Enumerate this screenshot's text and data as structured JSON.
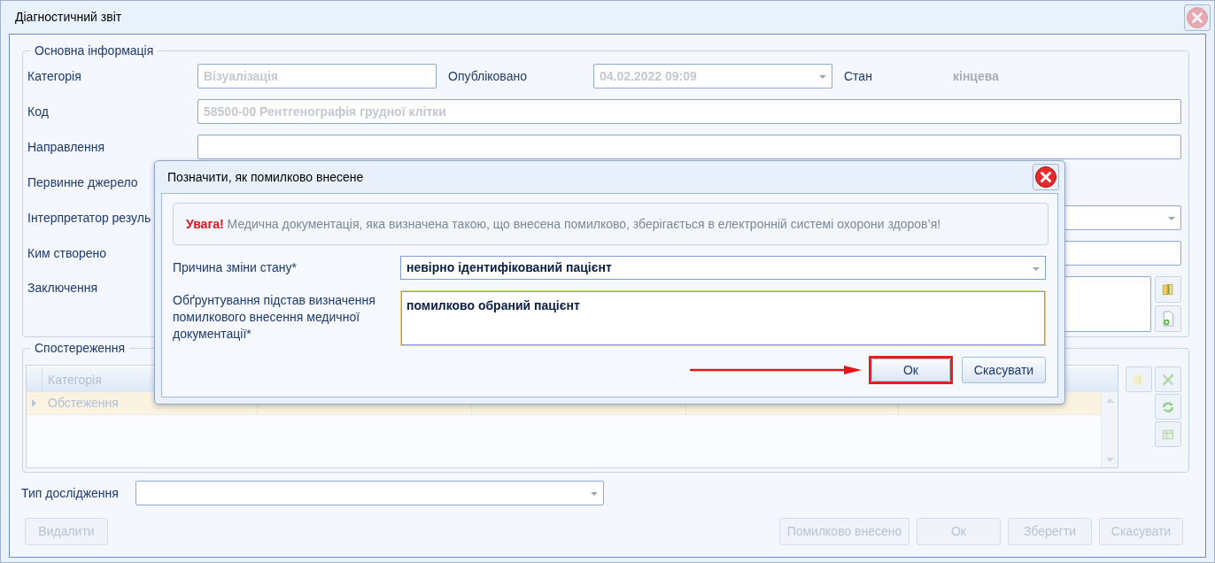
{
  "window": {
    "title": "Діагностичний звіт"
  },
  "main_info": {
    "legend": "Основна інформація",
    "category": {
      "label": "Категорія",
      "value": "Візуалізація"
    },
    "published": {
      "label": "Опубліковано",
      "value": "04.02.2022 09:09"
    },
    "status": {
      "label": "Стан",
      "value": "кінцева"
    },
    "fields": [
      {
        "label": "Код",
        "kind": "text",
        "value": "58500-00 Рентгенографія грудної клітки"
      },
      {
        "label": "Направлення",
        "kind": "text"
      },
      {
        "label": "Первинне джерело",
        "kind": "none"
      },
      {
        "label": "Інтерпретатор резуль",
        "kind": "select"
      },
      {
        "label": "Ким створено",
        "kind": "text"
      },
      {
        "label": "Заключення",
        "kind": "textarea"
      }
    ]
  },
  "observations": {
    "legend": "Спостереження",
    "columns": [
      "Категорія"
    ],
    "rows": [
      {
        "selected": true,
        "cells": [
          "Обстеження"
        ]
      }
    ]
  },
  "study_type": {
    "label": "Тип дослідження"
  },
  "buttons": [
    {
      "label": "Видалити",
      "disabled": true
    },
    {
      "label": "Помилково внесено",
      "disabled": true
    },
    {
      "label": "Ок",
      "disabled": true
    },
    {
      "label": "Зберегти",
      "disabled": true
    },
    {
      "label": "Скасувати",
      "disabled": true
    }
  ],
  "dialog": {
    "title": "Позначити, як помилково внесене",
    "warning": "**Увага!** Медична документація, яка визначена такою, що внесена помилково, зберігається в електронній системі охорони здоров’я!",
    "reason": {
      "label": "Причина зміни стану*",
      "value": "невірно ідентифікований пацієнт"
    },
    "justification": {
      "label": "Обґрунтування підстав визначення помилкового внесення медичної документації*",
      "value": "помилково обраний пацієнт"
    },
    "buttons": [
      {
        "label": "Ок",
        "highlighted": true
      },
      {
        "label": "Скасувати",
        "highlighted": false
      }
    ]
  }
}
